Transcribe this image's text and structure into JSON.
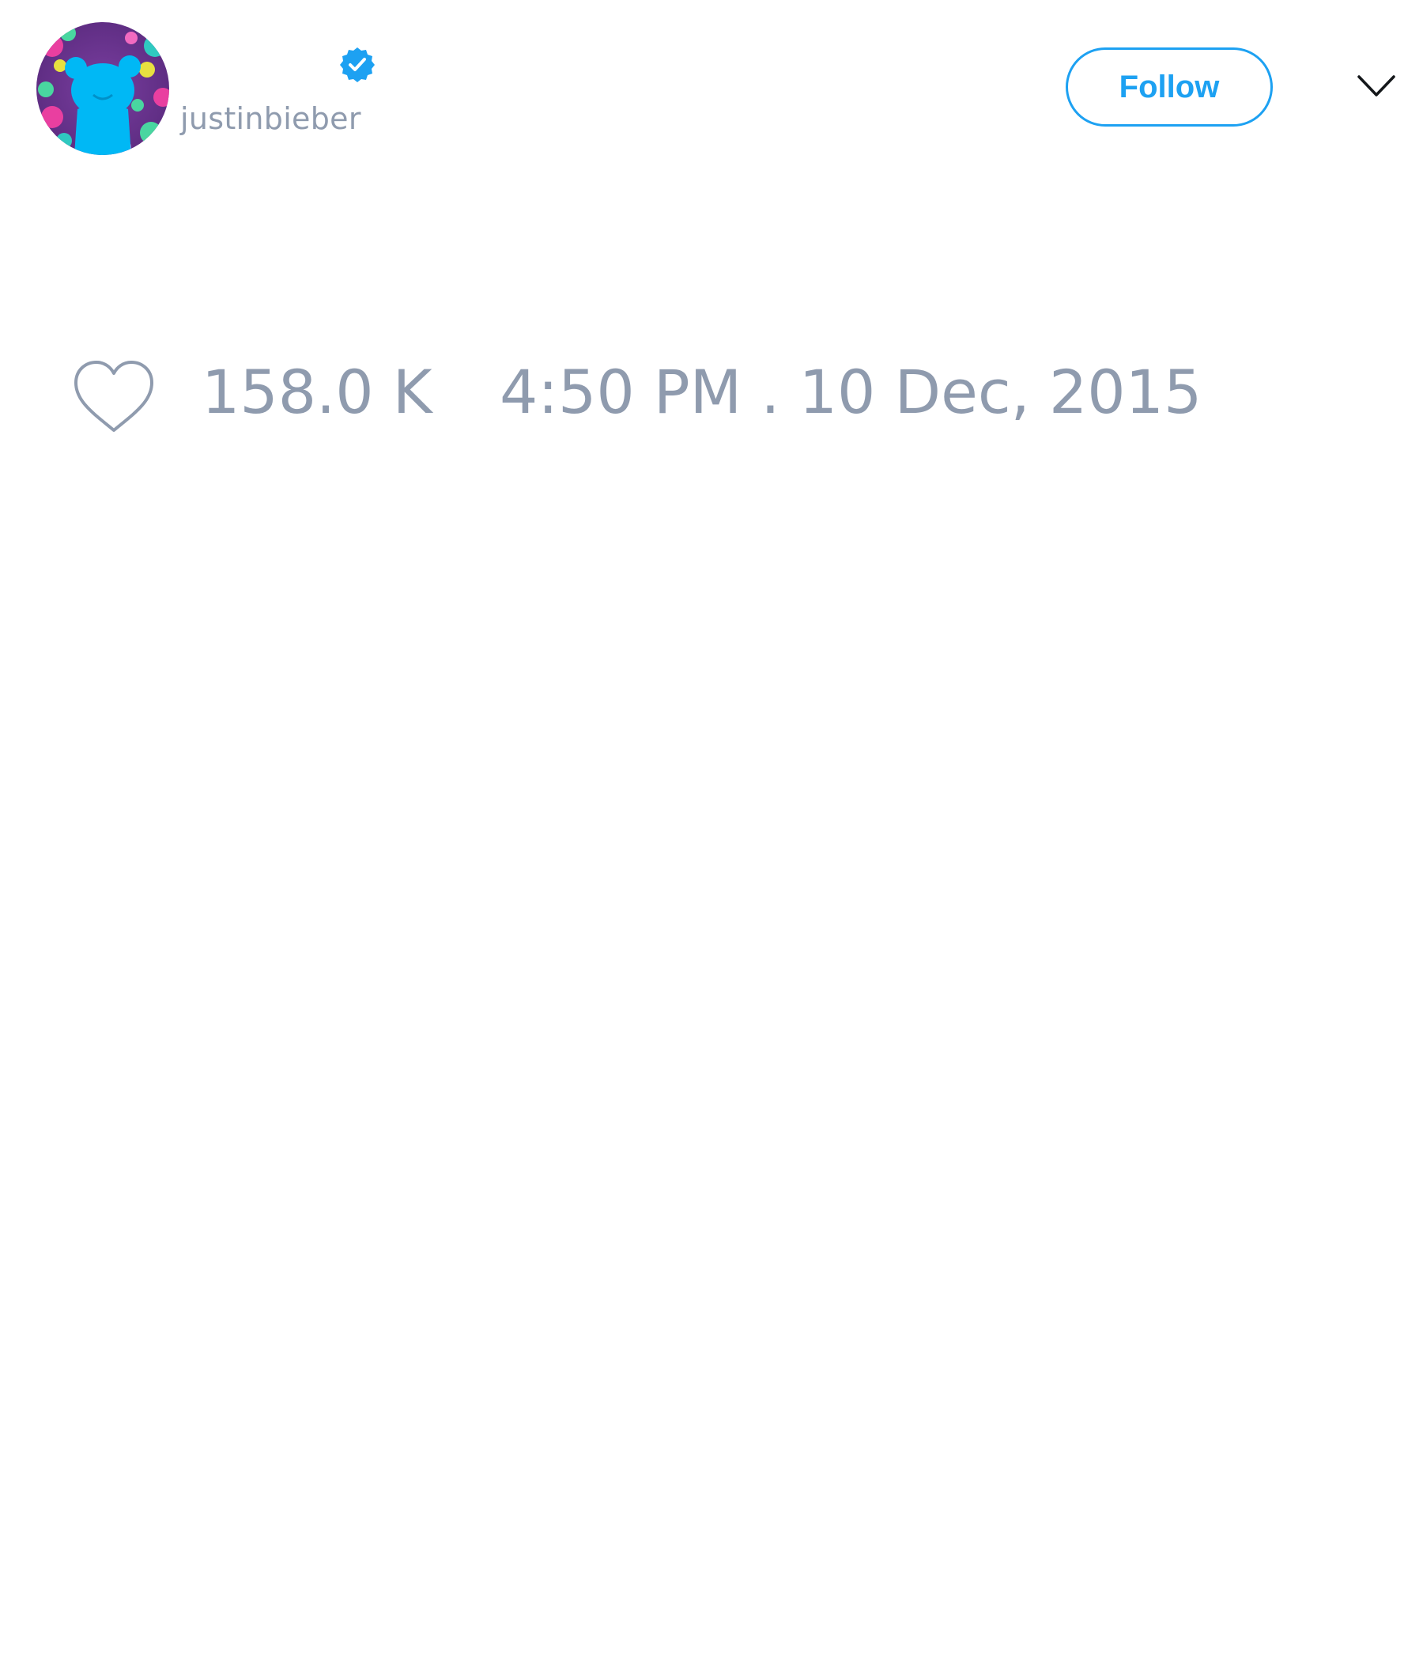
{
  "tweet": {
    "user": {
      "display_name": "",
      "handle": "justinbieber",
      "verified": true
    },
    "follow_label": "Follow",
    "likes": "158.0 K",
    "timestamp": "4:50 PM . 10 Dec, 2015"
  },
  "icons": {
    "verified": "verified-badge-icon",
    "more": "chevron-down-icon",
    "like": "heart-icon"
  },
  "colors": {
    "accent": "#1da1f2",
    "muted_text": "#8f9bae",
    "avatar_figure": "#00b8f5"
  }
}
